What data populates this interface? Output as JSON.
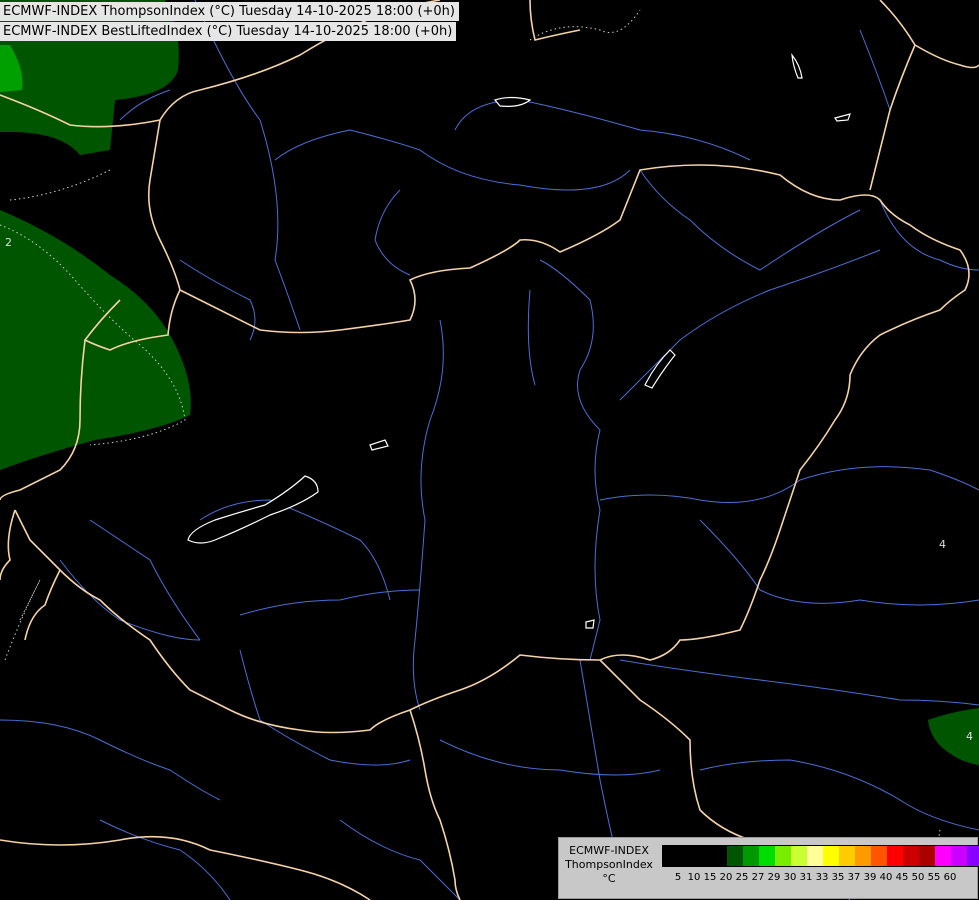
{
  "header": {
    "line1": "ECMWF-INDEX ThompsonIndex (°C) Tuesday 14-10-2025 18:00 (+0h)",
    "line2": "ECMWF-INDEX BestLiftedIndex (°C) Tuesday 14-10-2025 18:00 (+0h)"
  },
  "contour_labels": [
    "2",
    "4",
    "4"
  ],
  "legend": {
    "title_line1": "ECMWF-INDEX",
    "title_line2": "ThompsonIndex",
    "title_line3": "°C",
    "colors": [
      "#000000",
      "#000000",
      "#000000",
      "#000000",
      "#005500",
      "#009900",
      "#00dd00",
      "#77ee00",
      "#ccff33",
      "#ffff99",
      "#ffff00",
      "#ffcc00",
      "#ff9900",
      "#ff5500",
      "#ff0000",
      "#cc0000",
      "#aa0000",
      "#ff00ff",
      "#cc00ff",
      "#8800ff",
      "#6600ff",
      "#0000ff"
    ],
    "ticks": [
      "5",
      "10",
      "15",
      "20",
      "25",
      "27",
      "29",
      "30",
      "31",
      "33",
      "35",
      "37",
      "39",
      "40",
      "45",
      "50",
      "55",
      "60"
    ]
  },
  "colors": {
    "background": "#000000",
    "green_area": "#005500",
    "bright_green": "#00aa00",
    "borders": "#f5d3a6",
    "rivers": "#4a6fd8",
    "lakes": "#ffffff"
  }
}
